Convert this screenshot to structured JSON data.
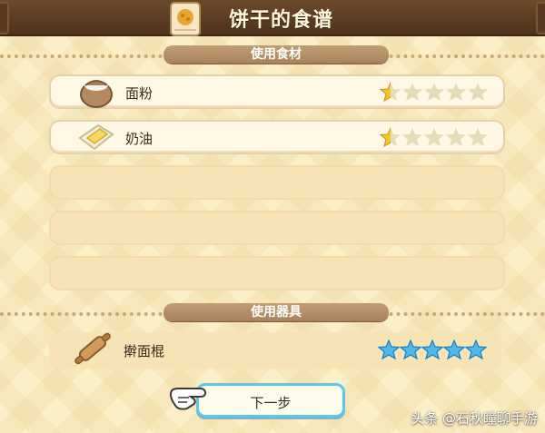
{
  "header": {
    "title": "饼干的食谱",
    "icon": "recipe-card-icon"
  },
  "sections": {
    "ingredients": {
      "title": "使用食材"
    },
    "tools": {
      "title": "使用器具"
    }
  },
  "ingredients": [
    {
      "name": "面粉",
      "icon": "flour-sack-icon",
      "rating": 0.5,
      "max_rating": 5
    },
    {
      "name": "奶油",
      "icon": "butter-icon",
      "rating": 0.5,
      "max_rating": 5
    }
  ],
  "tools": [
    {
      "name": "擀面棍",
      "icon": "rolling-pin-icon",
      "rating": 5,
      "max_rating": 5
    }
  ],
  "actions": {
    "next_label": "下一步",
    "pointer_icon": "pointing-hand-icon"
  },
  "watermark": "头条 @石秋瞳聊手游",
  "colors": {
    "star_gold": "#f2c531",
    "star_blue": "#4fb8ee",
    "star_empty": "#e6dbb8",
    "accent_border": "#5ec6ea"
  }
}
